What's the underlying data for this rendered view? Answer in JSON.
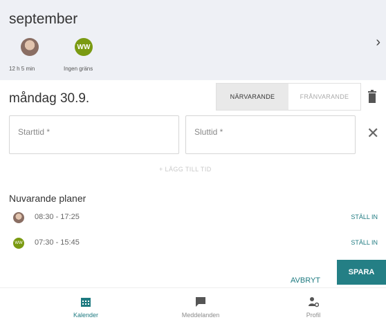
{
  "header": {
    "month": "september",
    "avatars": [
      {
        "type": "photo",
        "initials": "",
        "caption": "12 h 5 min"
      },
      {
        "type": "initials",
        "initials": "WW",
        "caption": "Ingen gräns"
      }
    ],
    "next_icon": "chevron-right-icon"
  },
  "day": {
    "date_label": "måndag 30.9.",
    "segment": {
      "present": "NÄRVARANDE",
      "absent": "FRÅNVARANDE",
      "selected": "present"
    },
    "delete_icon": "trash-icon"
  },
  "form": {
    "start_placeholder": "Starttid *",
    "end_placeholder": "Sluttid *",
    "clear_icon": "close-icon",
    "add_time_label": "+ LÄGG TILL TID"
  },
  "plans": {
    "title": "Nuvarande planer",
    "rows": [
      {
        "avatar": "photo",
        "initials": "",
        "time": "08:30 - 17:25",
        "action": "STÄLL IN"
      },
      {
        "avatar": "initials",
        "initials": "WW",
        "time": "07:30 - 15:45",
        "action": "STÄLL IN"
      }
    ]
  },
  "actions": {
    "cancel": "AVBRYT",
    "save": "SPARA"
  },
  "nav": {
    "items": [
      {
        "label": "Kalender",
        "icon": "calendar-icon",
        "active": true
      },
      {
        "label": "Meddelanden",
        "icon": "message-icon",
        "active": false
      },
      {
        "label": "Profil",
        "icon": "profile-icon",
        "active": false
      }
    ]
  },
  "colors": {
    "accent": "#247f85",
    "header_bg": "#eef0f5",
    "avatar_green": "#7a9a12"
  }
}
